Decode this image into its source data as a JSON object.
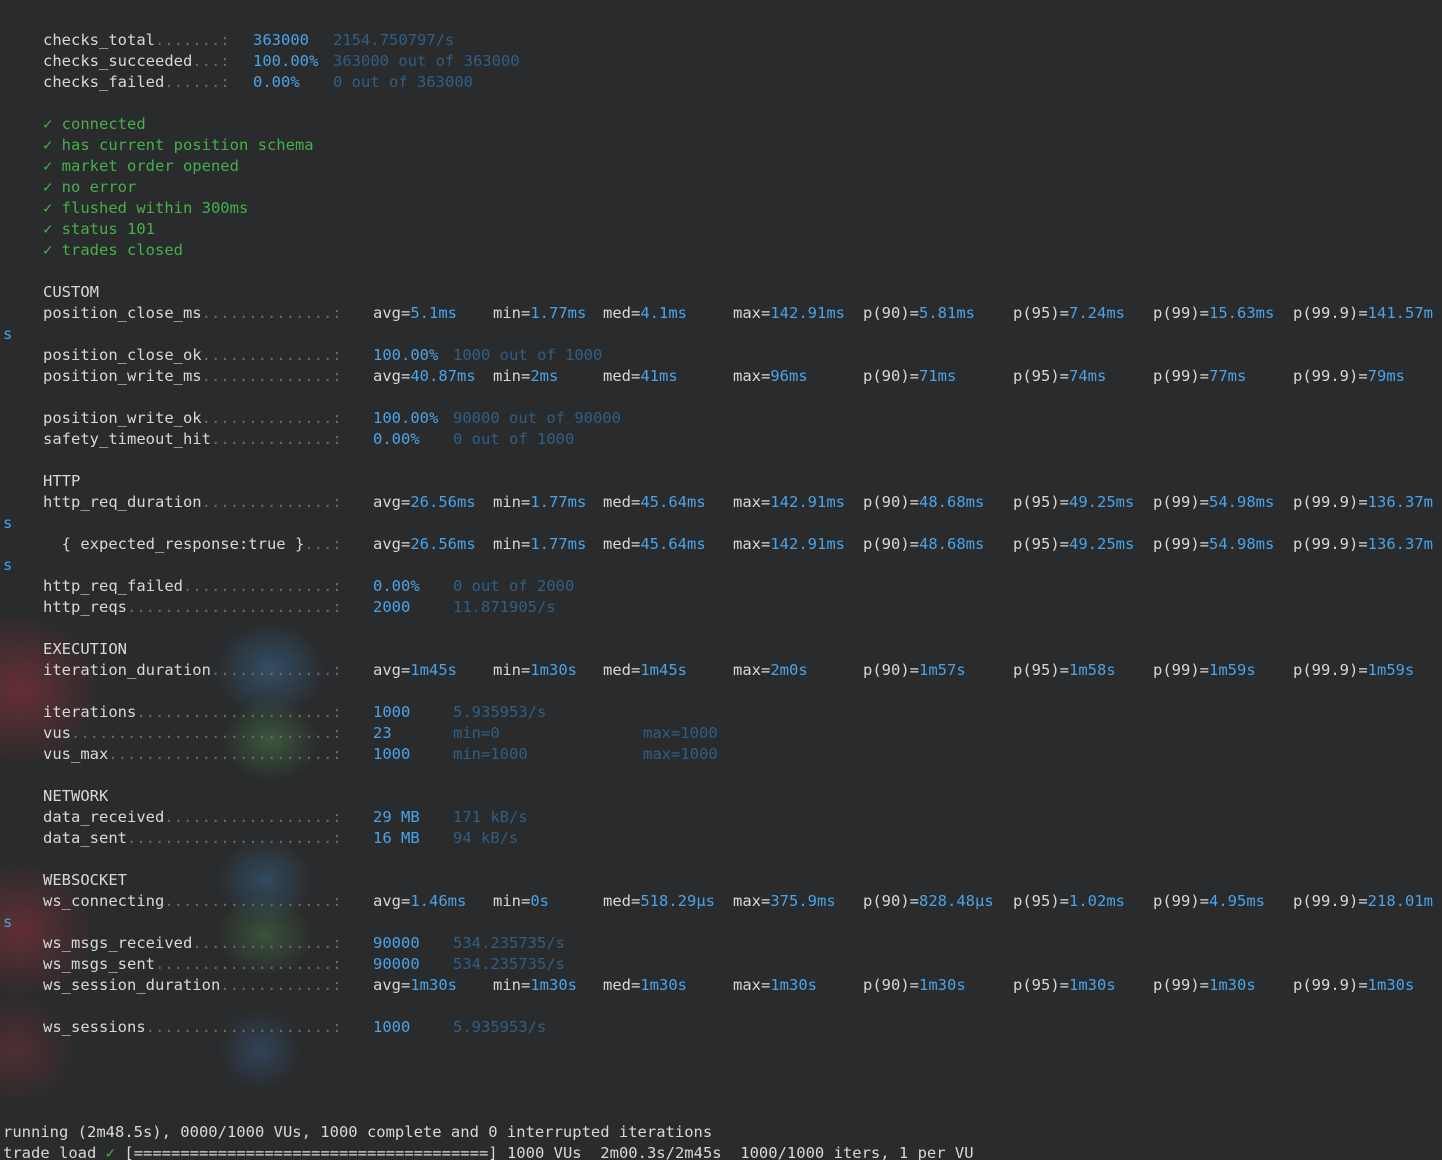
{
  "checks": [
    {
      "name": "checks_total",
      "dots": ".......:",
      "value": "363000",
      "extra": "2154.750797/s"
    },
    {
      "name": "checks_succeeded",
      "dots": "...:",
      "value": "100.00%",
      "extra": "363000 out of 363000"
    },
    {
      "name": "checks_failed",
      "dots": "......:",
      "value": "0.00%",
      "extra": "0 out of 363000"
    }
  ],
  "check_results": [
    "✓ connected",
    "✓ has current position schema",
    "✓ market order opened",
    "✓ no error",
    "✓ flushed within 300ms",
    "✓ status 101",
    "✓ trades closed"
  ],
  "sections": {
    "custom": "CUSTOM",
    "http": "HTTP",
    "execution": "EXECUTION",
    "network": "NETWORK",
    "websocket": "WEBSOCKET"
  },
  "trend_labels": {
    "avg": "avg=",
    "min": "min=",
    "med": "med=",
    "max": "max=",
    "p90": "p(90)=",
    "p95": "p(95)=",
    "p99": "p(99)=",
    "p999": "p(99.9)="
  },
  "metrics": {
    "position_close_ms": {
      "name": "position_close_ms",
      "dots": "..............:",
      "avg": "5.1ms",
      "min": "1.77ms",
      "med": "4.1ms",
      "max": "142.91ms",
      "p90": "5.81ms",
      "p95": "7.24ms",
      "p99": "15.63ms",
      "p999": "141.57m",
      "wrap": "s"
    },
    "position_close_ok": {
      "name": "position_close_ok",
      "dots": "..............:",
      "value": "100.00%",
      "extra": "1000 out of 1000"
    },
    "position_write_ms": {
      "name": "position_write_ms",
      "dots": "..............:",
      "avg": "40.87ms",
      "min": "2ms",
      "med": "41ms",
      "max": "96ms",
      "p90": "71ms",
      "p95": "74ms",
      "p99": "77ms",
      "p999": "79ms"
    },
    "position_write_ok": {
      "name": "position_write_ok",
      "dots": "..............:",
      "value": "100.00%",
      "extra": "90000 out of 90000"
    },
    "safety_timeout_hit": {
      "name": "safety_timeout_hit",
      "dots": ".............:",
      "value": "0.00%",
      "extra": "0 out of 1000"
    },
    "http_req_duration": {
      "name": "http_req_duration",
      "dots": "..............:",
      "avg": "26.56ms",
      "min": "1.77ms",
      "med": "45.64ms",
      "max": "142.91ms",
      "p90": "48.68ms",
      "p95": "49.25ms",
      "p99": "54.98ms",
      "p999": "136.37m",
      "wrap": "s"
    },
    "expected_response": {
      "name": "  { expected_response:true }",
      "dots": "...:",
      "avg": "26.56ms",
      "min": "1.77ms",
      "med": "45.64ms",
      "max": "142.91ms",
      "p90": "48.68ms",
      "p95": "49.25ms",
      "p99": "54.98ms",
      "p999": "136.37m",
      "wrap": "s"
    },
    "http_req_failed": {
      "name": "http_req_failed",
      "dots": "................:",
      "value": "0.00%",
      "extra": "0 out of 2000"
    },
    "http_reqs": {
      "name": "http_reqs",
      "dots": "......................:",
      "value": "2000",
      "extra": "11.871905/s"
    },
    "iteration_duration": {
      "name": "iteration_duration",
      "dots": ".............:",
      "avg": "1m45s",
      "min": "1m30s",
      "med": "1m45s",
      "max": "2m0s",
      "p90": "1m57s",
      "p95": "1m58s",
      "p99": "1m59s",
      "p999": "1m59s"
    },
    "iterations": {
      "name": "iterations",
      "dots": ".....................:",
      "value": "1000",
      "extra": "5.935953/s"
    },
    "vus": {
      "name": "vus",
      "dots": "............................:",
      "value": "23",
      "extra": "min=0",
      "extra2": "max=1000"
    },
    "vus_max": {
      "name": "vus_max",
      "dots": "........................:",
      "value": "1000",
      "extra": "min=1000",
      "extra2": "max=1000"
    },
    "data_received": {
      "name": "data_received",
      "dots": "..................:",
      "value": "29 MB",
      "extra": "171 kB/s"
    },
    "data_sent": {
      "name": "data_sent",
      "dots": "......................:",
      "value": "16 MB",
      "extra": "94 kB/s"
    },
    "ws_connecting": {
      "name": "ws_connecting",
      "dots": "..................:",
      "avg": "1.46ms",
      "min": "0s",
      "med": "518.29µs",
      "max": "375.9ms",
      "p90": "828.48µs",
      "p95": "1.02ms",
      "p99": "4.95ms",
      "p999": "218.01m",
      "wrap": "s"
    },
    "ws_msgs_received": {
      "name": "ws_msgs_received",
      "dots": "...............:",
      "value": "90000",
      "extra": "534.235735/s"
    },
    "ws_msgs_sent": {
      "name": "ws_msgs_sent",
      "dots": "...................:",
      "value": "90000",
      "extra": "534.235735/s"
    },
    "ws_session_duration": {
      "name": "ws_session_duration",
      "dots": "............:",
      "avg": "1m30s",
      "min": "1m30s",
      "med": "1m30s",
      "max": "1m30s",
      "p90": "1m30s",
      "p95": "1m30s",
      "p99": "1m30s",
      "p999": "1m30s"
    },
    "ws_sessions": {
      "name": "ws_sessions",
      "dots": "....................:",
      "value": "1000",
      "extra": "5.935953/s"
    }
  },
  "footer": {
    "running": "running (2m48.5s), 0000/1000 VUs, 1000 complete and 0 interrupted iterations",
    "scenario": "trade_load",
    "check_mark": "✓",
    "progress": "[======================================]",
    "progress_rest": " 1000 VUs  2m00.3s/2m45s  1000/1000 iters, 1 per VU"
  }
}
